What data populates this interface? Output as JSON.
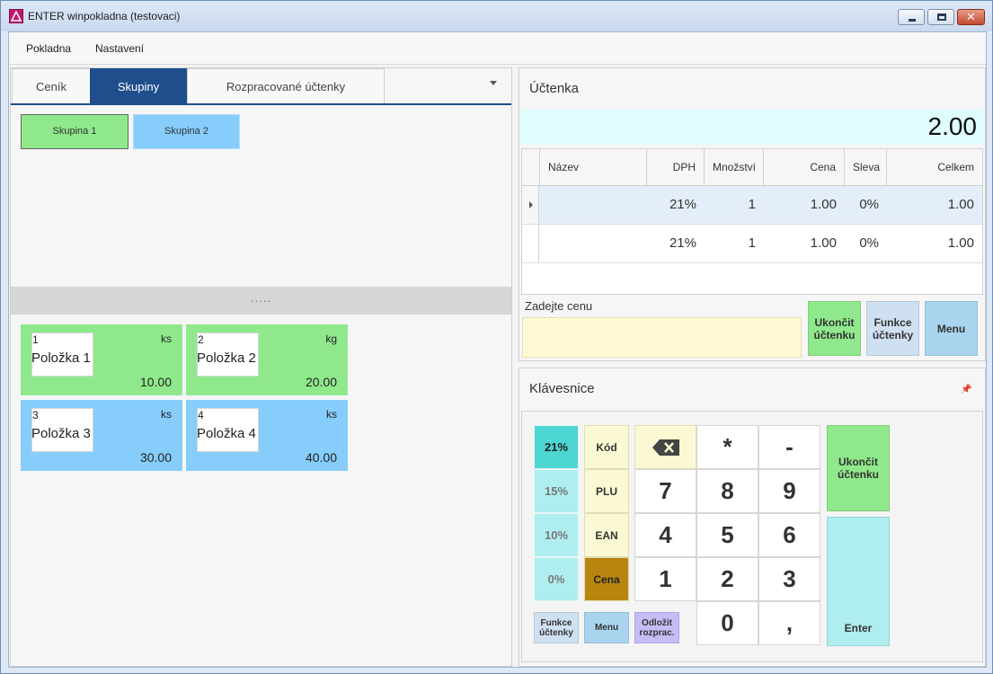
{
  "window": {
    "title": "ENTER winpokladna (testovaci)"
  },
  "menu": [
    "Pokladna",
    "Nastavení"
  ],
  "tabs": [
    "Ceník",
    "Skupiny",
    "Rozpracované účtenky"
  ],
  "groups": [
    "Skupina 1",
    "Skupina 2"
  ],
  "splitter": ".....",
  "products": [
    {
      "num": "1",
      "unit": "ks",
      "name": "Položka 1",
      "price": "10.00"
    },
    {
      "num": "2",
      "unit": "kg",
      "name": "Položka 2",
      "price": "20.00"
    },
    {
      "num": "3",
      "unit": "ks",
      "name": "Položka 3",
      "price": "30.00"
    },
    {
      "num": "4",
      "unit": "ks",
      "name": "Položka 4",
      "price": "40.00"
    }
  ],
  "receipt": {
    "title": "Účtenka",
    "total": "2.00",
    "columns": [
      "Název",
      "DPH",
      "Množství",
      "Cena",
      "Sleva",
      "Celkem"
    ],
    "rows": [
      [
        "",
        "21%",
        "1",
        "1.00",
        "0%",
        "1.00"
      ],
      [
        "",
        "21%",
        "1",
        "1.00",
        "0%",
        "1.00"
      ]
    ],
    "price_label": "Zadejte cenu",
    "price_value": "",
    "buttons": [
      "Ukončit účtenku",
      "Funkce účtenky",
      "Menu"
    ]
  },
  "keypad": {
    "title": "Klávesnice",
    "pin_icon": "pin-icon",
    "vat": [
      "21%",
      "15%",
      "10%",
      "0%"
    ],
    "codes": [
      "Kód",
      "PLU",
      "EAN",
      "Cena"
    ],
    "keys": [
      "*",
      "-",
      "7",
      "8",
      "9",
      "4",
      "5",
      "6",
      "1",
      "2",
      "3",
      "0",
      ","
    ],
    "backspace_icon": "backspace-icon",
    "small": [
      "Funkce účtenky",
      "Menu",
      "Odložit rozprac."
    ],
    "finish": "Ukončit účtenku",
    "enter": "Enter"
  },
  "colors": {
    "green": "#8fe98c",
    "blue": "#86cdfb",
    "tab_active": "#1f4e8c",
    "cyan": "#dffcff",
    "yellow": "#fff9d4"
  }
}
